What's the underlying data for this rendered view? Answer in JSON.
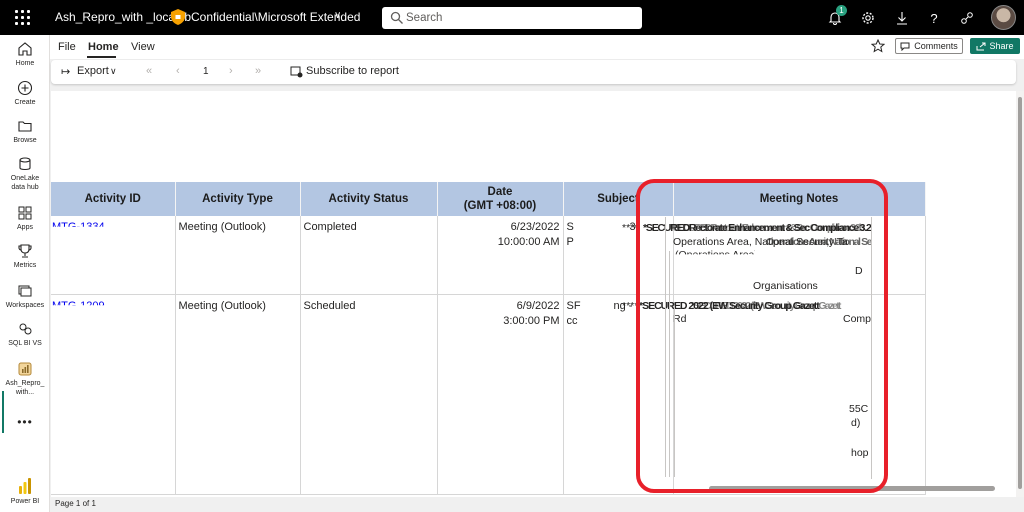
{
  "app": {
    "report_name": "Ash_Repro_with _localdb",
    "sensitivity_label": "Confidential\\Microsoft Extended",
    "search_placeholder": "Search",
    "notification_count": "1",
    "brand_color": "#117865",
    "highlight_color": "#e8202a"
  },
  "nav": {
    "items": [
      {
        "label": "Home",
        "icon": "home-icon"
      },
      {
        "label": "Create",
        "icon": "plus-circle-icon"
      },
      {
        "label": "Browse",
        "icon": "folder-icon"
      },
      {
        "label_line1": "OneLake",
        "label_line2": "data hub",
        "icon": "database-icon"
      },
      {
        "label": "Apps",
        "icon": "apps-icon"
      },
      {
        "label": "Metrics",
        "icon": "trophy-icon"
      },
      {
        "label": "Workspaces",
        "icon": "workspaces-icon"
      },
      {
        "label": "SQL BI VS",
        "icon": "workspace-icon"
      },
      {
        "label_line1": "Ash_Repro_",
        "label_line2": "with...",
        "icon": "report-icon"
      }
    ],
    "more": "•••",
    "powerbi_label": "Power BI"
  },
  "menu": {
    "tabs": [
      "File",
      "Home",
      "View"
    ],
    "active_tab": "Home",
    "comments_label": "Comments",
    "share_label": "Share"
  },
  "toolbar": {
    "export_label": "Export",
    "page_number": "1",
    "subscribe_label": "Subscribe to report"
  },
  "table": {
    "headers": [
      "Activity ID",
      "Activity Type",
      "Activity Status",
      "Date (GMT +08:00)",
      "Subject",
      "Meeting Notes"
    ],
    "header_date_line1": "Date",
    "header_date_line2": "(GMT +08:00)",
    "rows": [
      {
        "activity_id": "MTG-1334",
        "type": "Meeting (Outlook)",
        "status": "Completed",
        "date": "6/23/2022",
        "time": "10:00:00 AM",
        "subject_a": "S",
        "subject_b": "P",
        "subject_num": "3",
        "stars": "****",
        "notes_top": "*SECUREDRectorate Enhancement & Sec Compliance 3.2b",
        "notes_line2": "Operations Area, National Security Ta",
        "notes_line3": "(Operations Area)",
        "notes_line4": "Organisations",
        "notes_d": "D"
      },
      {
        "activity_id": "MTG-1209",
        "type": "Meeting (Outlook)",
        "status": "Scheduled",
        "date": "6/9/2022",
        "time": "3:00:00 PM",
        "subject_a": "SF",
        "subject_b": "cc",
        "subject_tail": "ng -",
        "stars": "****",
        "notes_top": "*SECURED 2022 (EW Security Group Gazett",
        "notes_rd": "Rd",
        "notes_comp": "Comp",
        "notes_55c": "55C",
        "notes_d": "d)",
        "notes_hop": "hop"
      }
    ]
  },
  "status": {
    "page_text": "Page 1 of 1"
  }
}
